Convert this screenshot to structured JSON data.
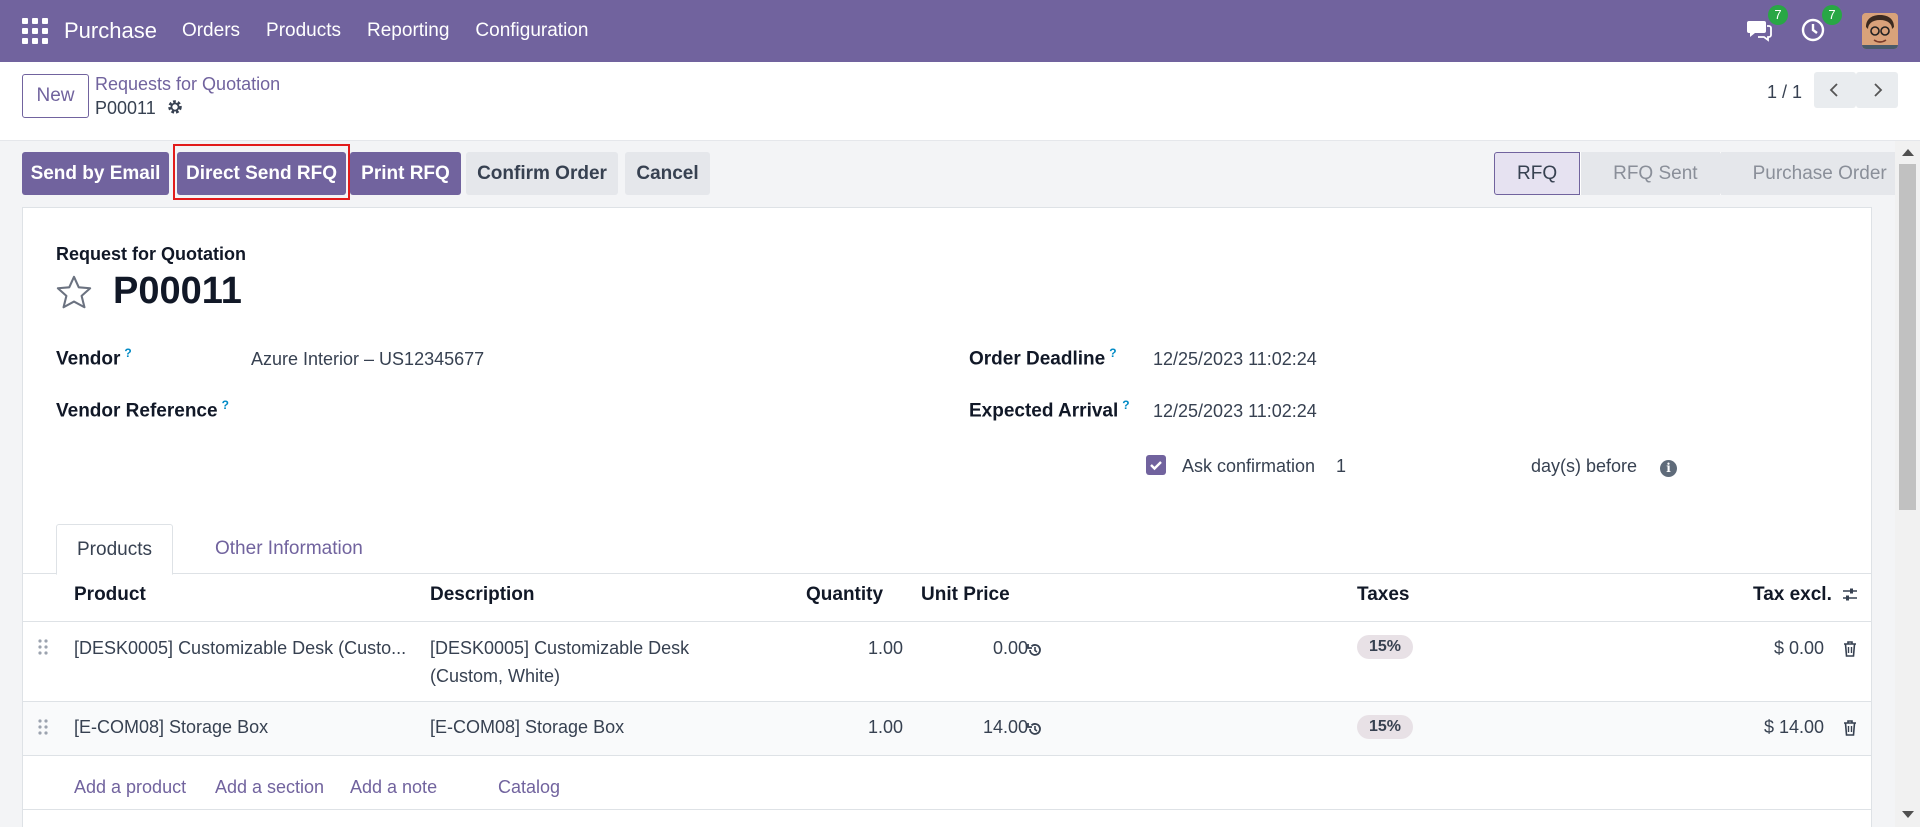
{
  "navbar": {
    "app_name": "Purchase",
    "menu": [
      "Orders",
      "Products",
      "Reporting",
      "Configuration"
    ],
    "messages_badge": "7",
    "activities_badge": "7"
  },
  "control_panel": {
    "new_label": "New",
    "breadcrumb_parent": "Requests for Quotation",
    "breadcrumb_current": "P00011",
    "pager": "1 / 1"
  },
  "actions": {
    "send_email": "Send by Email",
    "direct_send": "Direct Send RFQ",
    "print": "Print RFQ",
    "confirm": "Confirm Order",
    "cancel": "Cancel"
  },
  "status_stages": [
    "RFQ",
    "RFQ Sent",
    "Purchase Order"
  ],
  "form": {
    "doc_type": "Request for Quotation",
    "doc_name": "P00011",
    "vendor_label": "Vendor",
    "vendor_value": "Azure Interior – US12345677",
    "vendor_ref_label": "Vendor Reference",
    "order_deadline_label": "Order Deadline",
    "order_deadline_value": "12/25/2023 11:02:24",
    "expected_arrival_label": "Expected Arrival",
    "expected_arrival_value": "12/25/2023 11:02:24",
    "ask_confirmation_label": "Ask confirmation",
    "ask_confirmation_days": "1",
    "days_before_label": "day(s) before",
    "help_marker": "?"
  },
  "tabs": [
    "Products",
    "Other Information"
  ],
  "table": {
    "headers": {
      "product": "Product",
      "description": "Description",
      "quantity": "Quantity",
      "unit_price": "Unit Price",
      "taxes": "Taxes",
      "tax_excl": "Tax excl."
    },
    "rows": [
      {
        "product": "[DESK0005] Customizable Desk (Custo...",
        "description_line1": "[DESK0005] Customizable Desk",
        "description_line2": "(Custom, White)",
        "quantity": "1.00",
        "unit_price": "0.00",
        "tax": "15%",
        "subtotal": "$ 0.00"
      },
      {
        "product": "[E-COM08] Storage Box",
        "description_line1": "[E-COM08] Storage Box",
        "description_line2": "",
        "quantity": "1.00",
        "unit_price": "14.00",
        "tax": "15%",
        "subtotal": "$ 14.00"
      }
    ],
    "add_links": [
      "Add a product",
      "Add a section",
      "Add a note",
      "Catalog"
    ]
  },
  "colors": {
    "brand": "#71639e",
    "highlight_box": "#e21b1b",
    "badge": "#28a745"
  }
}
